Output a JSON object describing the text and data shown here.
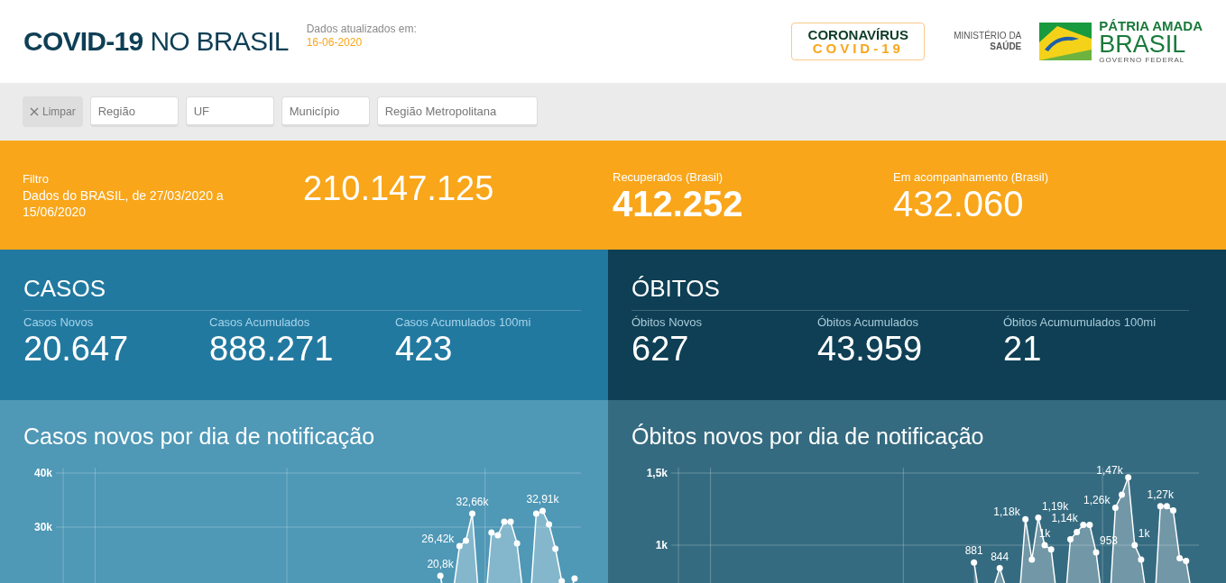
{
  "header": {
    "title_bold": "COVID-19",
    "title_light": "NO BRASIL",
    "updated_label": "Dados atualizados em:",
    "updated_date": "16-06-2020",
    "badge": {
      "line_1": "CORONAVÍRUS",
      "line_2": "COVID-19"
    },
    "ministry": {
      "line_1": "MINISTÉRIO DA",
      "line_2": "SAÚDE"
    },
    "government": {
      "line_1": "PÁTRIA AMADA",
      "line_2": "BRASIL",
      "line_3": "GOVERNO FEDERAL"
    }
  },
  "filters": {
    "clear_button": {
      "label": "Limpar",
      "disabled": true
    },
    "fields": [
      {
        "placeholder": "Região"
      },
      {
        "placeholder": "UF"
      },
      {
        "placeholder": "Município"
      },
      {
        "placeholder": "Região Metropolitana"
      }
    ]
  },
  "summary": {
    "filter_label": "Filtro",
    "filter_text": "Dados do BRASIL, de 27/03/2020 a 15/06/2020",
    "population": "210.147.125",
    "recovered": {
      "label": "Recuperados (Brasil)",
      "value": "412.252"
    },
    "monitoring": {
      "label": "Em acompanhamento (Brasil)",
      "value": "432.060"
    }
  },
  "panels": [
    {
      "title": "CASOS",
      "stats": [
        {
          "label": "Casos Novos",
          "value": "20.647"
        },
        {
          "label": "Casos Acumulados",
          "value": "888.271"
        },
        {
          "label": "Casos Acumulados 100mi",
          "value": "423"
        }
      ]
    },
    {
      "title": "ÓBITOS",
      "stats": [
        {
          "label": "Óbitos Novos",
          "value": "627"
        },
        {
          "label": "Óbitos Acumulados",
          "value": "43.959"
        },
        {
          "label": "Óbitos Acumumulados 100mi",
          "value": "21"
        }
      ]
    }
  ],
  "charts": [
    {
      "title": "Casos novos por dia de notificação",
      "chart_data": {
        "type": "area",
        "ylim": [
          0,
          40000
        ],
        "yticks": [
          {
            "value": 30000,
            "label": "30k"
          },
          {
            "value": 40000,
            "label": "40k"
          }
        ],
        "grid": true,
        "categories": [
          null,
          null,
          null,
          null,
          null,
          null,
          null,
          null,
          null,
          null,
          null,
          null,
          null,
          null,
          null,
          null,
          null,
          null,
          null,
          null,
          null,
          null,
          null,
          null,
          null,
          null,
          null,
          null,
          null,
          null,
          null,
          null,
          null,
          null,
          null,
          null,
          null,
          null,
          null,
          null,
          null,
          null,
          null,
          null,
          null,
          null,
          null,
          null,
          null,
          null,
          null,
          null,
          null,
          null,
          null,
          null,
          null,
          null,
          null,
          null,
          null,
          null,
          null,
          null,
          null,
          null,
          null,
          null,
          null,
          null,
          null,
          null,
          null,
          null,
          null,
          null,
          null,
          null,
          null,
          null,
          null
        ],
        "series": [
          {
            "color": "#ffffff",
            "values": [
              null,
              null,
              null,
              null,
              null,
              null,
              null,
              null,
              null,
              null,
              null,
              null,
              null,
              null,
              null,
              null,
              null,
              null,
              null,
              null,
              null,
              null,
              null,
              null,
              null,
              null,
              null,
              null,
              null,
              null,
              null,
              null,
              null,
              null,
              null,
              null,
              null,
              null,
              null,
              null,
              null,
              null,
              null,
              null,
              null,
              null,
              null,
              null,
              null,
              null,
              null,
              null,
              null,
              null,
              null,
              null,
              null,
              null,
              null,
              21000,
              15000,
              18000,
              26500,
              27500,
              32500,
              17000,
              15000,
              29000,
              28500,
              31000,
              31000,
              27000,
              17000,
              15000,
              32500,
              33000,
              30500,
              26000,
              20000,
              17000,
              20500
            ]
          }
        ],
        "value_labels": [
          null,
          null,
          null,
          null,
          null,
          null,
          null,
          null,
          null,
          null,
          null,
          null,
          null,
          null,
          null,
          null,
          null,
          null,
          null,
          null,
          null,
          null,
          null,
          null,
          null,
          null,
          null,
          null,
          null,
          null,
          null,
          null,
          null,
          null,
          null,
          null,
          null,
          null,
          null,
          null,
          null,
          null,
          null,
          null,
          null,
          null,
          null,
          null,
          null,
          null,
          null,
          null,
          null,
          null,
          null,
          null,
          null,
          null,
          null,
          "20,8k",
          null,
          null,
          "26,42k",
          null,
          "32,66k",
          null,
          null,
          null,
          null,
          null,
          null,
          null,
          null,
          null,
          null,
          "32,91k",
          null,
          null,
          null,
          null,
          null
        ]
      }
    },
    {
      "title": "Óbitos novos por dia de notificação",
      "chart_data": {
        "type": "area",
        "ylim": [
          0,
          1500
        ],
        "yticks": [
          {
            "value": 1000,
            "label": "1k"
          },
          {
            "value": 1500,
            "label": "1,5k"
          }
        ],
        "grid": true,
        "categories": [
          null,
          null,
          null,
          null,
          null,
          null,
          null,
          null,
          null,
          null,
          null,
          null,
          null,
          null,
          null,
          null,
          null,
          null,
          null,
          null,
          null,
          null,
          null,
          null,
          null,
          null,
          null,
          null,
          null,
          null,
          null,
          null,
          null,
          null,
          null,
          null,
          null,
          null,
          null,
          null,
          null,
          null,
          null,
          null,
          null,
          null,
          null,
          null,
          null,
          null,
          null,
          null,
          null,
          null,
          null,
          null,
          null,
          null,
          null,
          null,
          null,
          null,
          null,
          null,
          null,
          null,
          null,
          null,
          null,
          null,
          null,
          null,
          null,
          null,
          null,
          null,
          null,
          null,
          null,
          null,
          null
        ],
        "series": [
          {
            "color": "#ffffff",
            "values": [
              null,
              null,
              null,
              null,
              null,
              null,
              null,
              null,
              null,
              null,
              null,
              null,
              null,
              null,
              null,
              null,
              null,
              null,
              null,
              null,
              null,
              null,
              null,
              null,
              null,
              null,
              null,
              null,
              null,
              null,
              null,
              null,
              null,
              null,
              null,
              null,
              null,
              null,
              null,
              null,
              null,
              null,
              null,
              null,
              null,
              null,
              880,
              600,
              450,
              700,
              840,
              700,
              500,
              600,
              1180,
              900,
              1190,
              1000,
              970,
              600,
              500,
              1040,
              1090,
              1140,
              1140,
              950,
              600,
              500,
              1260,
              1350,
              1470,
              1000,
              900,
              600,
              500,
              1270,
              1270,
              1240,
              910,
              890,
              630
            ]
          }
        ],
        "value_labels": [
          null,
          null,
          null,
          null,
          null,
          null,
          null,
          null,
          null,
          null,
          null,
          null,
          null,
          null,
          null,
          null,
          null,
          null,
          null,
          null,
          null,
          null,
          null,
          null,
          null,
          null,
          null,
          null,
          null,
          null,
          null,
          null,
          null,
          null,
          null,
          null,
          null,
          null,
          null,
          null,
          null,
          null,
          null,
          null,
          null,
          null,
          "881",
          null,
          null,
          null,
          "844",
          null,
          null,
          null,
          "1,18k",
          null,
          "1,19k",
          "1k",
          null,
          null,
          null,
          null,
          null,
          "1,14k",
          null,
          "953",
          null,
          null,
          "1,26k",
          null,
          "1,47k",
          "1k",
          null,
          null,
          null,
          "1,27k",
          null,
          null,
          null,
          null,
          null
        ]
      }
    }
  ]
}
